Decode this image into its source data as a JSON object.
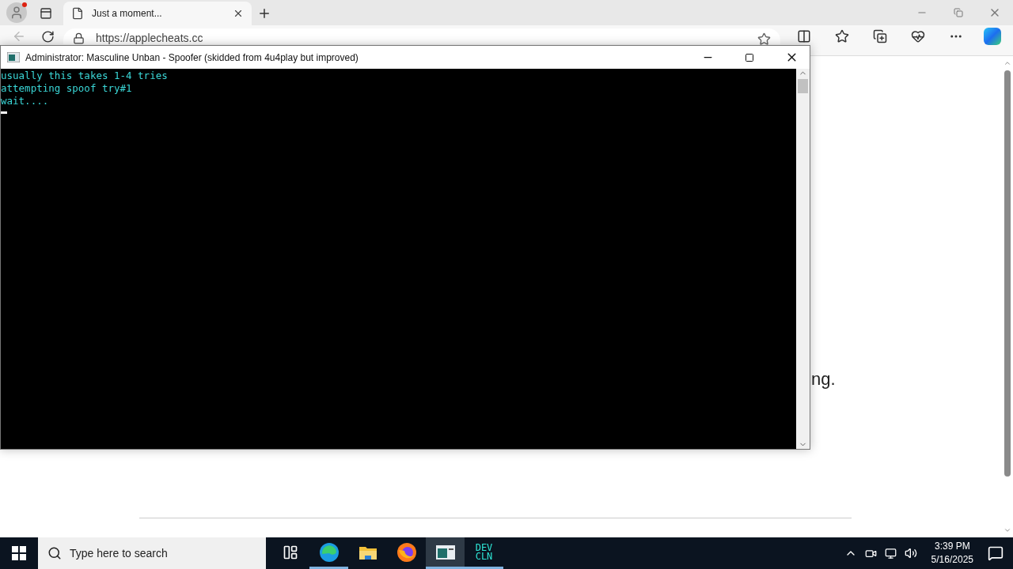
{
  "browser": {
    "tab": {
      "title": "Just a moment...",
      "selected": true
    },
    "address": "https://applecheats.cc",
    "page_text": "ng."
  },
  "console": {
    "title": "Administrator:  Masculine Unban - Spoofer (skidded from 4u4play but improved)",
    "lines": [
      "usually this takes 1-4 tries",
      "attempting spoof try#1",
      "wait...."
    ]
  },
  "taskbar": {
    "search": {
      "placeholder": "Type here to search"
    },
    "apps": [
      {
        "kind": "taskview",
        "running": false,
        "selected": false
      },
      {
        "kind": "edge",
        "running": true,
        "selected": false
      },
      {
        "kind": "folder",
        "running": false,
        "selected": false
      },
      {
        "kind": "firefox",
        "running": false,
        "selected": false
      },
      {
        "kind": "console",
        "running": true,
        "selected": true
      },
      {
        "kind": "text",
        "label": "DEV CLN",
        "running": true,
        "selected": false
      }
    ],
    "clock": {
      "time": "3:39 PM",
      "date": "5/16/2025"
    }
  }
}
